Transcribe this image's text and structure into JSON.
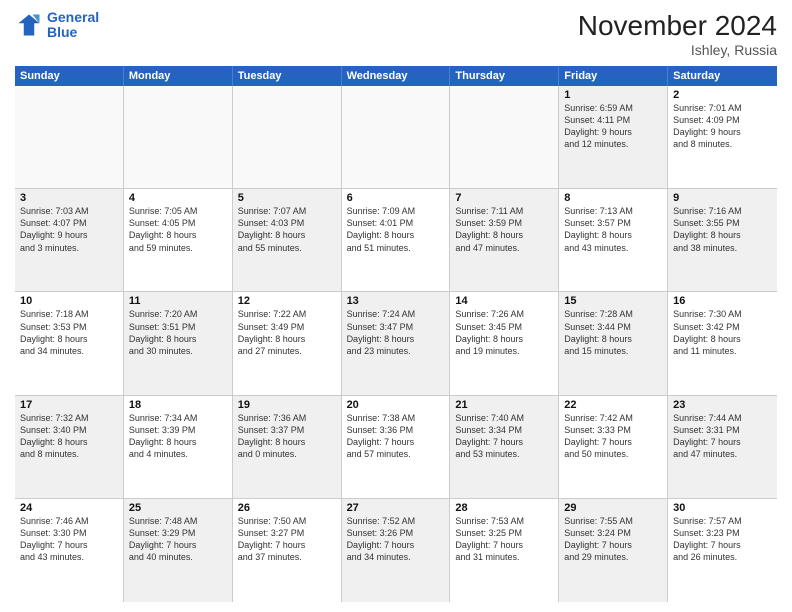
{
  "header": {
    "logo_line1": "General",
    "logo_line2": "Blue",
    "month_title": "November 2024",
    "location": "Ishley, Russia"
  },
  "weekdays": [
    "Sunday",
    "Monday",
    "Tuesday",
    "Wednesday",
    "Thursday",
    "Friday",
    "Saturday"
  ],
  "weeks": [
    [
      {
        "day": "",
        "text": "",
        "empty": true
      },
      {
        "day": "",
        "text": "",
        "empty": true
      },
      {
        "day": "",
        "text": "",
        "empty": true
      },
      {
        "day": "",
        "text": "",
        "empty": true
      },
      {
        "day": "",
        "text": "",
        "empty": true
      },
      {
        "day": "1",
        "text": "Sunrise: 6:59 AM\nSunset: 4:11 PM\nDaylight: 9 hours\nand 12 minutes.",
        "empty": false,
        "shaded": true
      },
      {
        "day": "2",
        "text": "Sunrise: 7:01 AM\nSunset: 4:09 PM\nDaylight: 9 hours\nand 8 minutes.",
        "empty": false,
        "shaded": false
      }
    ],
    [
      {
        "day": "3",
        "text": "Sunrise: 7:03 AM\nSunset: 4:07 PM\nDaylight: 9 hours\nand 3 minutes.",
        "empty": false,
        "shaded": true
      },
      {
        "day": "4",
        "text": "Sunrise: 7:05 AM\nSunset: 4:05 PM\nDaylight: 8 hours\nand 59 minutes.",
        "empty": false,
        "shaded": false
      },
      {
        "day": "5",
        "text": "Sunrise: 7:07 AM\nSunset: 4:03 PM\nDaylight: 8 hours\nand 55 minutes.",
        "empty": false,
        "shaded": true
      },
      {
        "day": "6",
        "text": "Sunrise: 7:09 AM\nSunset: 4:01 PM\nDaylight: 8 hours\nand 51 minutes.",
        "empty": false,
        "shaded": false
      },
      {
        "day": "7",
        "text": "Sunrise: 7:11 AM\nSunset: 3:59 PM\nDaylight: 8 hours\nand 47 minutes.",
        "empty": false,
        "shaded": true
      },
      {
        "day": "8",
        "text": "Sunrise: 7:13 AM\nSunset: 3:57 PM\nDaylight: 8 hours\nand 43 minutes.",
        "empty": false,
        "shaded": false
      },
      {
        "day": "9",
        "text": "Sunrise: 7:16 AM\nSunset: 3:55 PM\nDaylight: 8 hours\nand 38 minutes.",
        "empty": false,
        "shaded": true
      }
    ],
    [
      {
        "day": "10",
        "text": "Sunrise: 7:18 AM\nSunset: 3:53 PM\nDaylight: 8 hours\nand 34 minutes.",
        "empty": false,
        "shaded": false
      },
      {
        "day": "11",
        "text": "Sunrise: 7:20 AM\nSunset: 3:51 PM\nDaylight: 8 hours\nand 30 minutes.",
        "empty": false,
        "shaded": true
      },
      {
        "day": "12",
        "text": "Sunrise: 7:22 AM\nSunset: 3:49 PM\nDaylight: 8 hours\nand 27 minutes.",
        "empty": false,
        "shaded": false
      },
      {
        "day": "13",
        "text": "Sunrise: 7:24 AM\nSunset: 3:47 PM\nDaylight: 8 hours\nand 23 minutes.",
        "empty": false,
        "shaded": true
      },
      {
        "day": "14",
        "text": "Sunrise: 7:26 AM\nSunset: 3:45 PM\nDaylight: 8 hours\nand 19 minutes.",
        "empty": false,
        "shaded": false
      },
      {
        "day": "15",
        "text": "Sunrise: 7:28 AM\nSunset: 3:44 PM\nDaylight: 8 hours\nand 15 minutes.",
        "empty": false,
        "shaded": true
      },
      {
        "day": "16",
        "text": "Sunrise: 7:30 AM\nSunset: 3:42 PM\nDaylight: 8 hours\nand 11 minutes.",
        "empty": false,
        "shaded": false
      }
    ],
    [
      {
        "day": "17",
        "text": "Sunrise: 7:32 AM\nSunset: 3:40 PM\nDaylight: 8 hours\nand 8 minutes.",
        "empty": false,
        "shaded": true
      },
      {
        "day": "18",
        "text": "Sunrise: 7:34 AM\nSunset: 3:39 PM\nDaylight: 8 hours\nand 4 minutes.",
        "empty": false,
        "shaded": false
      },
      {
        "day": "19",
        "text": "Sunrise: 7:36 AM\nSunset: 3:37 PM\nDaylight: 8 hours\nand 0 minutes.",
        "empty": false,
        "shaded": true
      },
      {
        "day": "20",
        "text": "Sunrise: 7:38 AM\nSunset: 3:36 PM\nDaylight: 7 hours\nand 57 minutes.",
        "empty": false,
        "shaded": false
      },
      {
        "day": "21",
        "text": "Sunrise: 7:40 AM\nSunset: 3:34 PM\nDaylight: 7 hours\nand 53 minutes.",
        "empty": false,
        "shaded": true
      },
      {
        "day": "22",
        "text": "Sunrise: 7:42 AM\nSunset: 3:33 PM\nDaylight: 7 hours\nand 50 minutes.",
        "empty": false,
        "shaded": false
      },
      {
        "day": "23",
        "text": "Sunrise: 7:44 AM\nSunset: 3:31 PM\nDaylight: 7 hours\nand 47 minutes.",
        "empty": false,
        "shaded": true
      }
    ],
    [
      {
        "day": "24",
        "text": "Sunrise: 7:46 AM\nSunset: 3:30 PM\nDaylight: 7 hours\nand 43 minutes.",
        "empty": false,
        "shaded": false
      },
      {
        "day": "25",
        "text": "Sunrise: 7:48 AM\nSunset: 3:29 PM\nDaylight: 7 hours\nand 40 minutes.",
        "empty": false,
        "shaded": true
      },
      {
        "day": "26",
        "text": "Sunrise: 7:50 AM\nSunset: 3:27 PM\nDaylight: 7 hours\nand 37 minutes.",
        "empty": false,
        "shaded": false
      },
      {
        "day": "27",
        "text": "Sunrise: 7:52 AM\nSunset: 3:26 PM\nDaylight: 7 hours\nand 34 minutes.",
        "empty": false,
        "shaded": true
      },
      {
        "day": "28",
        "text": "Sunrise: 7:53 AM\nSunset: 3:25 PM\nDaylight: 7 hours\nand 31 minutes.",
        "empty": false,
        "shaded": false
      },
      {
        "day": "29",
        "text": "Sunrise: 7:55 AM\nSunset: 3:24 PM\nDaylight: 7 hours\nand 29 minutes.",
        "empty": false,
        "shaded": true
      },
      {
        "day": "30",
        "text": "Sunrise: 7:57 AM\nSunset: 3:23 PM\nDaylight: 7 hours\nand 26 minutes.",
        "empty": false,
        "shaded": false
      }
    ]
  ]
}
